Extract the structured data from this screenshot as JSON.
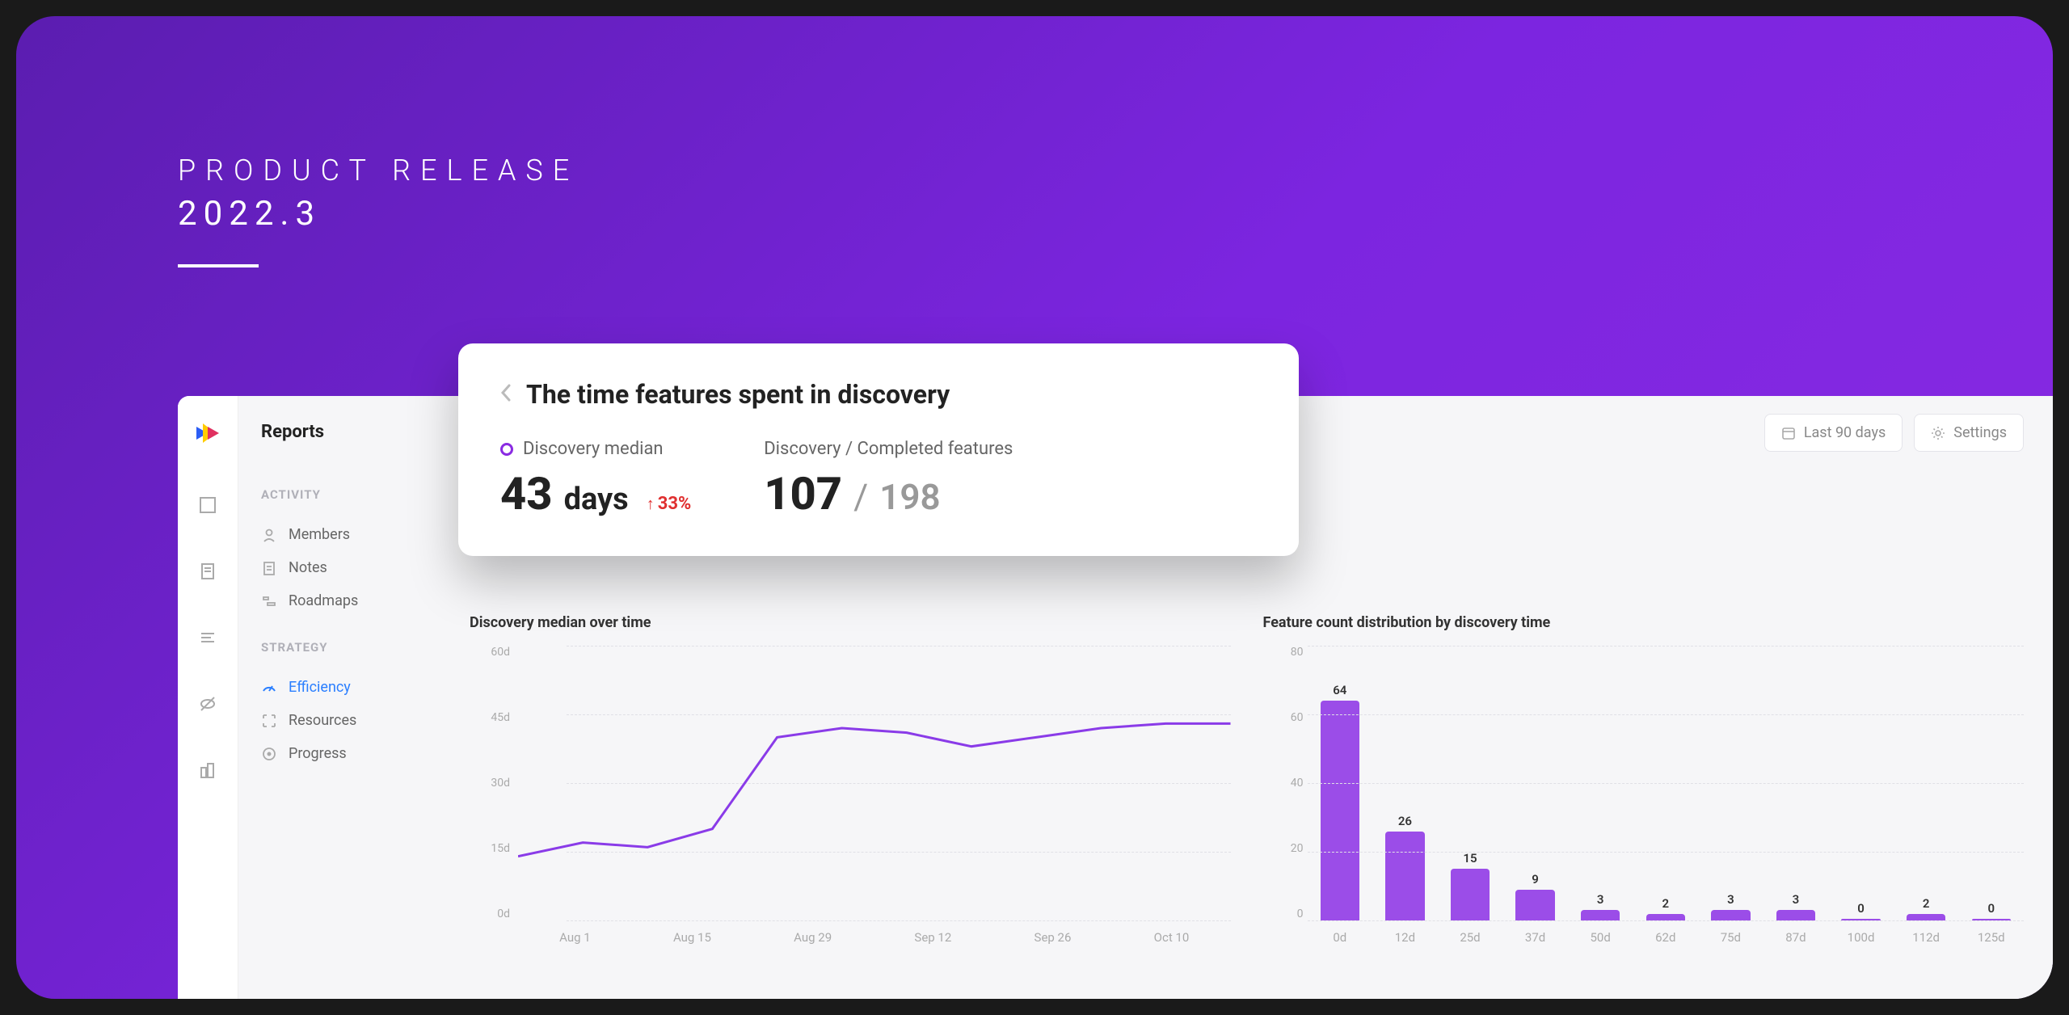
{
  "banner": {
    "label": "PRODUCT RELEASE",
    "version": "2022.3"
  },
  "sidebar": {
    "title": "Reports",
    "sections": [
      {
        "label": "ACTIVITY",
        "items": [
          {
            "label": "Members"
          },
          {
            "label": "Notes"
          },
          {
            "label": "Roadmaps"
          }
        ]
      },
      {
        "label": "STRATEGY",
        "items": [
          {
            "label": "Efficiency",
            "active": true
          },
          {
            "label": "Resources"
          },
          {
            "label": "Progress"
          }
        ]
      }
    ]
  },
  "toolbar": {
    "date_range": "Last 90 days",
    "settings": "Settings"
  },
  "hero": {
    "title": "The time features spent in discovery",
    "metric1": {
      "label": "Discovery median",
      "value": "43",
      "unit": "days",
      "change": "33%"
    },
    "metric2": {
      "label": "Discovery / Completed features",
      "value": "107",
      "total": "198"
    }
  },
  "charts": {
    "line": {
      "title": "Discovery median over time"
    },
    "bar": {
      "title": "Feature count distribution by discovery time"
    }
  },
  "chart_data": [
    {
      "type": "line",
      "title": "Discovery median over time",
      "xlabel": "",
      "ylabel": "",
      "ylim": [
        0,
        60
      ],
      "y_ticks": [
        "60d",
        "45d",
        "30d",
        "15d",
        "0d"
      ],
      "x_ticks": [
        "Aug 1",
        "Aug 15",
        "Aug 29",
        "Sep 12",
        "Sep 26",
        "Oct 10"
      ],
      "series": [
        {
          "name": "Discovery median",
          "x": [
            "Aug 1",
            "Aug 8",
            "Aug 15",
            "Aug 22",
            "Aug 29",
            "Sep 5",
            "Sep 12",
            "Sep 19",
            "Sep 26",
            "Oct 3",
            "Oct 10",
            "Oct 17"
          ],
          "y": [
            14,
            17,
            16,
            20,
            40,
            42,
            41,
            38,
            40,
            42,
            43,
            43
          ]
        }
      ]
    },
    {
      "type": "bar",
      "title": "Feature count distribution by discovery time",
      "xlabel": "",
      "ylabel": "",
      "ylim": [
        0,
        80
      ],
      "y_ticks": [
        "80",
        "60",
        "40",
        "20",
        "0"
      ],
      "categories": [
        "0d",
        "12d",
        "25d",
        "37d",
        "50d",
        "62d",
        "75d",
        "87d",
        "100d",
        "112d",
        "125d"
      ],
      "values": [
        64,
        26,
        15,
        9,
        3,
        2,
        3,
        3,
        0,
        2,
        0
      ]
    }
  ]
}
